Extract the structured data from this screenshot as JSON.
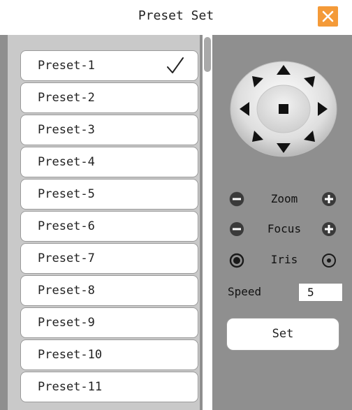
{
  "dialog": {
    "title": "Preset Set",
    "close_icon": "close-icon"
  },
  "presets": [
    {
      "label": "Preset-1",
      "selected": true
    },
    {
      "label": "Preset-2",
      "selected": false
    },
    {
      "label": "Preset-3",
      "selected": false
    },
    {
      "label": "Preset-4",
      "selected": false
    },
    {
      "label": "Preset-5",
      "selected": false
    },
    {
      "label": "Preset-6",
      "selected": false
    },
    {
      "label": "Preset-7",
      "selected": false
    },
    {
      "label": "Preset-8",
      "selected": false
    },
    {
      "label": "Preset-9",
      "selected": false
    },
    {
      "label": "Preset-10",
      "selected": false
    },
    {
      "label": "Preset-11",
      "selected": false
    }
  ],
  "controls": {
    "zoom_label": "Zoom",
    "focus_label": "Focus",
    "iris_label": "Iris",
    "speed_label": "Speed",
    "speed_value": "5",
    "set_label": "Set"
  },
  "colors": {
    "accent": "#f49a38",
    "panel": "#8f8f8f",
    "list_bg": "#c9c9c9"
  }
}
